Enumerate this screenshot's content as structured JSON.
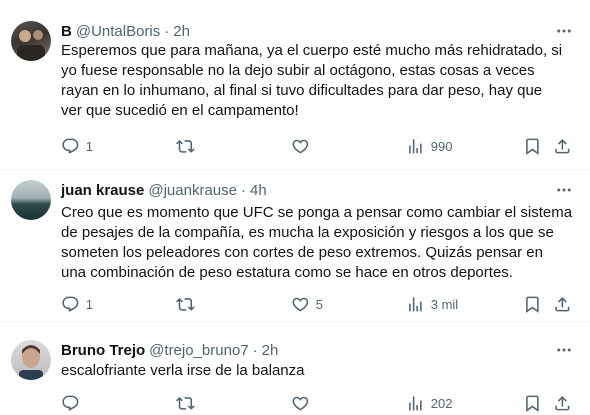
{
  "tweets": [
    {
      "name": "B",
      "handle": "@UntalBoris",
      "time": "2h",
      "lines": [
        "Esperemos que para mañana, ya el cuerpo esté mucho más rehidratado, si",
        "yo fuese responsable no la dejo subir al octágono, estas cosas a veces",
        "rayan en lo inhumano, al final si tuvo dificultades para dar peso, hay que",
        "ver que sucedió en el campamento!"
      ],
      "replies": "1",
      "retweets": "",
      "likes": "",
      "views": "990"
    },
    {
      "name": "juan krause",
      "handle": "@juankrause",
      "time": "4h",
      "lines": [
        "Creo que es momento que UFC se ponga a pensar como cambiar el sistema",
        "de pesajes de la compañía, es mucha la exposición y riesgos a los que se",
        "someten los peleadores con cortes de peso extremos. Quizás pensar en",
        "una combinación de peso estatura como se hace en otros deportes."
      ],
      "replies": "1",
      "retweets": "",
      "likes": "5",
      "views": "3 mil"
    },
    {
      "name": "Bruno Trejo",
      "handle": "@trejo_bruno7",
      "time": "2h",
      "lines": [
        "escalofriante verla irse de la balanza"
      ],
      "replies": "",
      "retweets": "",
      "likes": "",
      "views": "202"
    }
  ],
  "separator": "·",
  "icons": {
    "more": "more-horizontal-icon",
    "reply": "reply-icon",
    "retweet": "retweet-icon",
    "like": "heart-icon",
    "views": "views-chart-icon",
    "bookmark": "bookmark-icon",
    "share": "share-icon"
  },
  "colors": {
    "text": "#0f1419",
    "secondary": "#536471",
    "divider": "#eff3f4"
  }
}
